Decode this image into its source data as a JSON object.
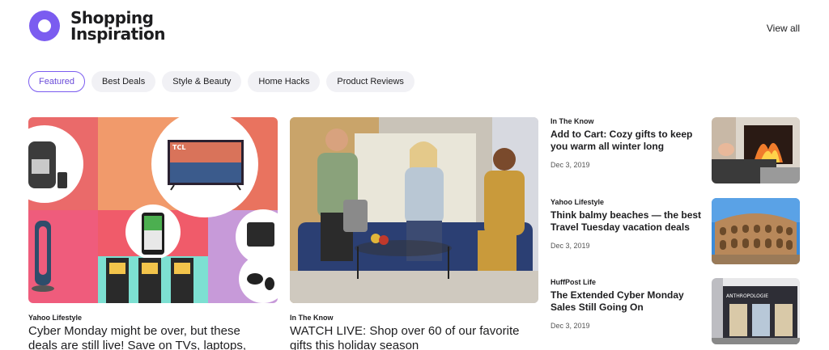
{
  "header": {
    "title": "Shopping Inspiration",
    "view_all": "View all"
  },
  "tabs": [
    {
      "label": "Featured",
      "active": true
    },
    {
      "label": "Best Deals"
    },
    {
      "label": "Style & Beauty"
    },
    {
      "label": "Home Hacks"
    },
    {
      "label": "Product Reviews"
    }
  ],
  "featured": [
    {
      "source": "Yahoo Lifestyle",
      "headline": "Cyber Monday might be over, but these deals are still live! Save on TVs, laptops,"
    },
    {
      "source": "In The Know",
      "headline": "WATCH LIVE: Shop over 60 of our favorite gifts this holiday season"
    }
  ],
  "side": [
    {
      "source": "In The Know",
      "headline": "Add to Cart: Cozy gifts to keep you warm all winter long",
      "date": "Dec 3, 2019"
    },
    {
      "source": "Yahoo Lifestyle",
      "headline": "Think balmy beaches — the best Travel Tuesday vacation deals",
      "date": "Dec 3, 2019"
    },
    {
      "source": "HuffPost Life",
      "headline": "The Extended Cyber Monday Sales Still Going On",
      "date": "Dec 3, 2019"
    }
  ],
  "image_text": {
    "tv_brand": "TCL",
    "store_sign": "ANTHROPOLOGIE"
  },
  "colors": {
    "accent": "#7b5cf0"
  }
}
